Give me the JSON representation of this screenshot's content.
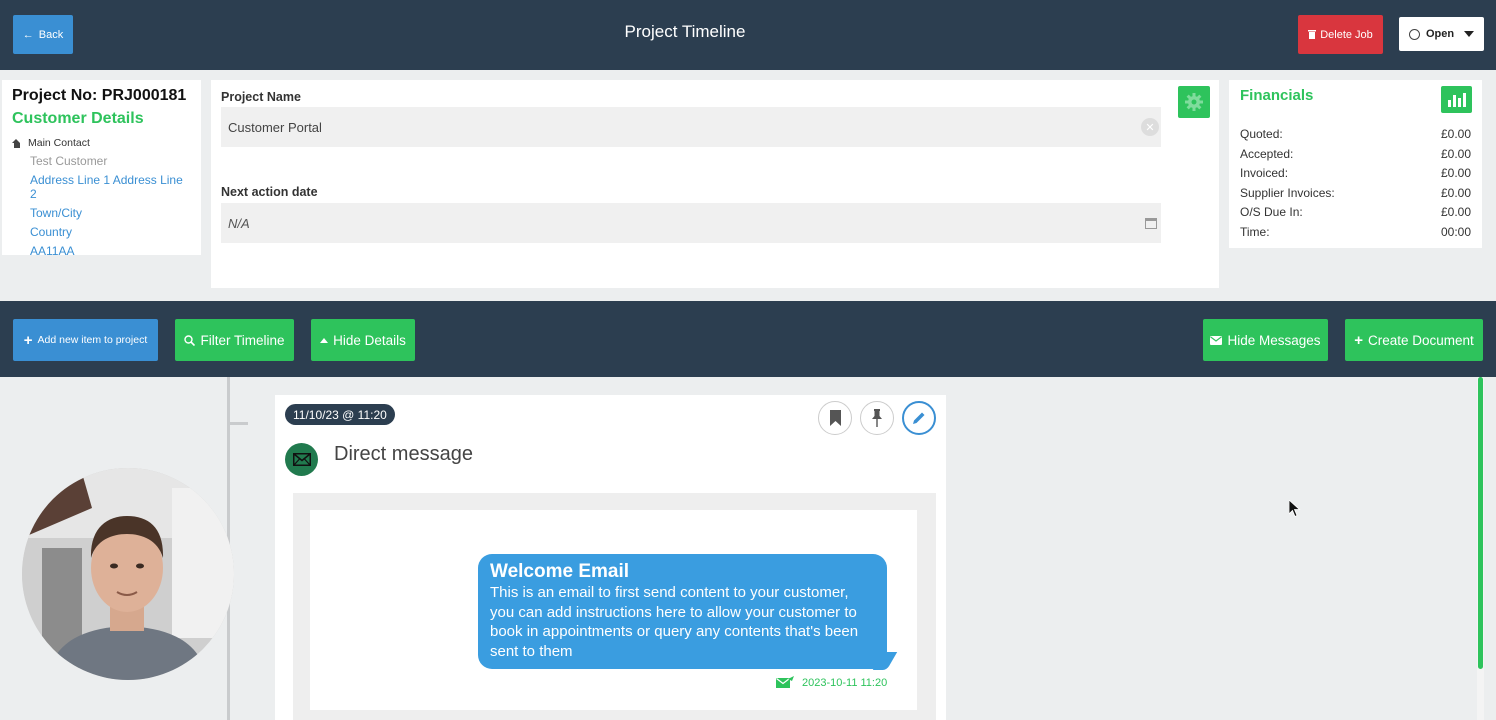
{
  "header": {
    "back_label": "Back",
    "title": "Project Timeline",
    "delete_label": "Delete Job",
    "status_value": "Open"
  },
  "customer": {
    "project_no": "Project No: PRJ000181",
    "heading": "Customer Details",
    "contact_label": "Main Contact",
    "name": "Test Customer",
    "address": "Address Line 1 Address Line 2",
    "town": "Town/City",
    "country": "Country",
    "postcode": "AA11AA"
  },
  "project_form": {
    "name_label": "Project Name",
    "name_value": "Customer Portal",
    "next_action_label": "Next action date",
    "next_action_value": "N/A"
  },
  "financials": {
    "title": "Financials",
    "rows": [
      {
        "label": "Quoted:",
        "value": "£0.00"
      },
      {
        "label": "Accepted:",
        "value": "£0.00"
      },
      {
        "label": "Invoiced:",
        "value": "£0.00"
      },
      {
        "label": "Supplier Invoices:",
        "value": "£0.00"
      },
      {
        "label": "O/S Due In:",
        "value": "£0.00"
      },
      {
        "label": "Time:",
        "value": "00:00"
      }
    ]
  },
  "actions": {
    "add_item": "Add new item to project",
    "filter": "Filter Timeline",
    "hide_details": "Hide Details",
    "hide_messages": "Hide Messages",
    "create_document": "Create Document"
  },
  "timeline": {
    "entry": {
      "date": "11/10/23 @ 11:20",
      "title": "Direct message",
      "message_title": "Welcome Email",
      "message_body": "This is an email to first send content to your customer, you can add instructions here to allow your customer to book in appointments or query any contents that's been sent to them",
      "sent_timestamp": "2023-10-11 11:20"
    }
  },
  "colors": {
    "navy": "#2c3e50",
    "blue": "#3a8fd3",
    "green": "#2ec35c",
    "red": "#d9363e"
  }
}
